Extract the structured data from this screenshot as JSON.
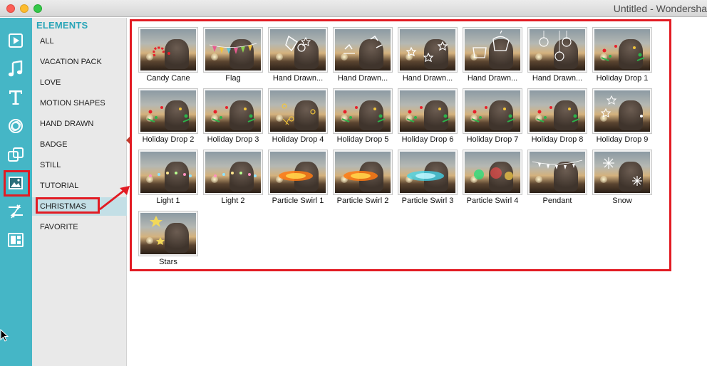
{
  "window": {
    "title": "Untitled - Wondersha"
  },
  "rail": {
    "items": [
      {
        "name": "media-icon"
      },
      {
        "name": "music-icon"
      },
      {
        "name": "text-icon"
      },
      {
        "name": "filter-icon"
      },
      {
        "name": "overlay-icon"
      },
      {
        "name": "elements-icon",
        "selected": true
      },
      {
        "name": "transition-icon"
      },
      {
        "name": "split-screen-icon"
      }
    ]
  },
  "categories": {
    "title": "ELEMENTS",
    "items": [
      {
        "label": "ALL"
      },
      {
        "label": "VACATION PACK"
      },
      {
        "label": "LOVE"
      },
      {
        "label": "MOTION SHAPES"
      },
      {
        "label": "HAND DRAWN"
      },
      {
        "label": "BADGE"
      },
      {
        "label": "STILL"
      },
      {
        "label": "TUTORIAL"
      },
      {
        "label": "CHRISTMAS",
        "selected": true
      },
      {
        "label": "FAVORITE"
      }
    ]
  },
  "elements": [
    {
      "label": "Candy Cane",
      "fx": "candy"
    },
    {
      "label": "Flag",
      "fx": "flag"
    },
    {
      "label": "Hand Drawn...",
      "fx": "drawn1"
    },
    {
      "label": "Hand Drawn...",
      "fx": "drawn2"
    },
    {
      "label": "Hand Drawn...",
      "fx": "drawn3"
    },
    {
      "label": "Hand Drawn...",
      "fx": "drawn4"
    },
    {
      "label": "Hand Drawn...",
      "fx": "drawn5"
    },
    {
      "label": "Holiday Drop 1",
      "fx": "drop"
    },
    {
      "label": "Holiday Drop 2",
      "fx": "drop"
    },
    {
      "label": "Holiday Drop 3",
      "fx": "drop"
    },
    {
      "label": "Holiday Drop 4",
      "fx": "dropgold"
    },
    {
      "label": "Holiday Drop 5",
      "fx": "drop"
    },
    {
      "label": "Holiday Drop 6",
      "fx": "drop"
    },
    {
      "label": "Holiday Drop 7",
      "fx": "drop"
    },
    {
      "label": "Holiday Drop 8",
      "fx": "drop"
    },
    {
      "label": "Holiday Drop 9",
      "fx": "dropwhite"
    },
    {
      "label": "Light 1",
      "fx": "light"
    },
    {
      "label": "Light 2",
      "fx": "light"
    },
    {
      "label": "Particle Swirl 1",
      "fx": "swirlfire"
    },
    {
      "label": "Particle Swirl 2",
      "fx": "swirlfire"
    },
    {
      "label": "Particle Swirl 3",
      "fx": "swirlcyan"
    },
    {
      "label": "Particle Swirl 4",
      "fx": "swirlgreen"
    },
    {
      "label": "Pendant",
      "fx": "pendant"
    },
    {
      "label": "Snow",
      "fx": "snow"
    },
    {
      "label": "Stars",
      "fx": "stars"
    }
  ],
  "colors": {
    "rail": "#45b6c6",
    "accent": "#2aa5b8",
    "callout": "#e21b23",
    "selected_category": "#c3dfe6"
  }
}
